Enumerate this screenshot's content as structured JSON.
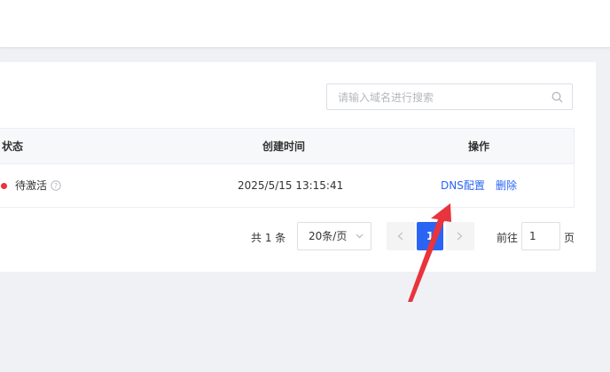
{
  "search": {
    "placeholder": "请输入域名进行搜索"
  },
  "table": {
    "headers": {
      "status": "状态",
      "created": "创建时间",
      "actions": "操作"
    },
    "rows": [
      {
        "status": "待激活",
        "created": "2025/5/15 13:15:41",
        "actions": {
          "dns": "DNS配置",
          "delete": "删除"
        }
      }
    ]
  },
  "pagination": {
    "total": "共 1 条",
    "page_size": "20条/页",
    "current_page": "1",
    "goto_label": "前往",
    "goto_value": "1",
    "goto_unit": "页"
  },
  "colors": {
    "accent": "#2a64f5",
    "status_pending": "#e8343c",
    "annotation": "#e8343c"
  },
  "icons": [
    "search-icon",
    "help-icon",
    "chevron-down-icon",
    "chevron-left-icon",
    "chevron-right-icon",
    "red-arrow-annotation"
  ]
}
